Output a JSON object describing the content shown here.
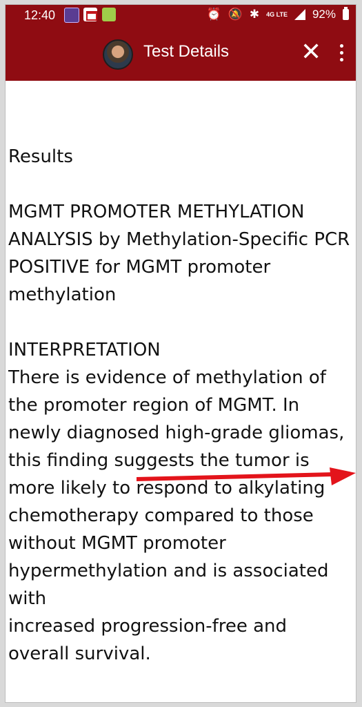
{
  "status_bar": {
    "time": "12:40",
    "network": "4G LTE",
    "battery": "92%",
    "icons": [
      "alarm-icon",
      "mute-icon",
      "bluetooth-icon",
      "signal-icon",
      "battery-icon"
    ]
  },
  "app_bar": {
    "title": "Test Details",
    "close_label": "✕",
    "bg_color": "#8f0c12"
  },
  "report": {
    "section1_heading": "Results",
    "test_name": "MGMT PROMOTER METHYLATION ANALYSIS by Methylation-Specific PCR",
    "result": "POSITIVE for MGMT promoter methylation",
    "section2_heading": "INTERPRETATION",
    "interpretation_1": "There is evidence of methylation of the promoter region of MGMT. In newly diagnosed high-grade gliomas, this finding suggests the tumor is more likely to respond to alkylating chemotherapy compared to those without MGMT promoter hypermethylation and is associated with",
    "interpretation_2": "increased progression-free and overall survival."
  },
  "annotation": {
    "arrow_color": "#e3141b"
  }
}
